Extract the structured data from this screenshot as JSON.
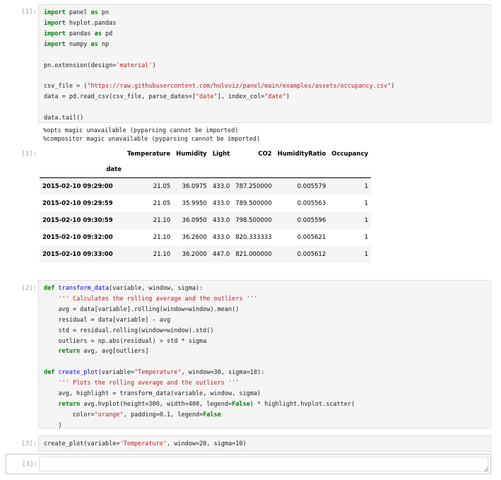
{
  "cells": {
    "c1": {
      "prompt": "[1]:",
      "lines": [
        [
          [
            "kw",
            "import"
          ],
          [
            "t",
            " panel "
          ],
          [
            "kw",
            "as"
          ],
          [
            "t",
            " pn"
          ]
        ],
        [
          [
            "kw",
            "import"
          ],
          [
            "t",
            " hvplot.pandas"
          ]
        ],
        [
          [
            "kw",
            "import"
          ],
          [
            "t",
            " pandas "
          ],
          [
            "kw",
            "as"
          ],
          [
            "t",
            " pd"
          ]
        ],
        [
          [
            "kw",
            "import"
          ],
          [
            "t",
            " numpy "
          ],
          [
            "kw",
            "as"
          ],
          [
            "t",
            " np"
          ]
        ],
        [],
        [
          [
            "t",
            "pn.extension(design="
          ],
          [
            "str",
            "'material'"
          ],
          [
            "t",
            ")"
          ]
        ],
        [],
        [
          [
            "t",
            "csv_file = ("
          ],
          [
            "str",
            "\"https://raw.githubusercontent.com/holoviz/panel/main/examples/assets/occupancy.csv\""
          ],
          [
            "t",
            ")"
          ]
        ],
        [
          [
            "t",
            "data = pd.read_csv(csv_file, parse_dates=["
          ],
          [
            "str",
            "\"date\""
          ],
          [
            "t",
            "], index_col="
          ],
          [
            "str",
            "\"date\""
          ],
          [
            "t",
            ")"
          ]
        ],
        [],
        [
          [
            "t",
            "data.tail()"
          ]
        ]
      ]
    },
    "stdout": "%opts magic unavailable (pyparsing cannot be imported)\n%compositor magic unavailable (pyparsing cannot be imported)",
    "out1": {
      "prompt": "[1]:",
      "columns": [
        "Temperature",
        "Humidity",
        "Light",
        "CO2",
        "HumidityRatio",
        "Occupancy"
      ],
      "index_name": "date",
      "rows": [
        {
          "index": "2015-02-10 09:29:00",
          "values": [
            "21.05",
            "36.0975",
            "433.0",
            "787.250000",
            "0.005579",
            "1"
          ]
        },
        {
          "index": "2015-02-10 09:29:59",
          "values": [
            "21.05",
            "35.9950",
            "433.0",
            "789.500000",
            "0.005563",
            "1"
          ]
        },
        {
          "index": "2015-02-10 09:30:59",
          "values": [
            "21.10",
            "36.0950",
            "433.0",
            "798.500000",
            "0.005596",
            "1"
          ]
        },
        {
          "index": "2015-02-10 09:32:00",
          "values": [
            "21.10",
            "36.2600",
            "433.0",
            "820.333333",
            "0.005621",
            "1"
          ]
        },
        {
          "index": "2015-02-10 09:33:00",
          "values": [
            "21.10",
            "36.2000",
            "447.0",
            "821.000000",
            "0.005612",
            "1"
          ]
        }
      ]
    },
    "c2": {
      "prompt": "[2]:",
      "lines": [
        [
          [
            "kw",
            "def"
          ],
          [
            "t",
            " "
          ],
          [
            "fn",
            "transform_data"
          ],
          [
            "t",
            "(variable, window, sigma):"
          ]
        ],
        [
          [
            "t",
            "    "
          ],
          [
            "str",
            "''' Calculates the rolling average and the outliers '''"
          ]
        ],
        [
          [
            "t",
            "    avg = data[variable].rolling(window=window).mean()"
          ]
        ],
        [
          [
            "t",
            "    residual = data[variable] - avg"
          ]
        ],
        [
          [
            "t",
            "    std = residual.rolling(window=window).std()"
          ]
        ],
        [
          [
            "t",
            "    outliers = np.abs(residual) > std * sigma"
          ]
        ],
        [
          [
            "t",
            "    "
          ],
          [
            "kw",
            "return"
          ],
          [
            "t",
            " avg, avg[outliers]"
          ]
        ],
        [],
        [
          [
            "kw",
            "def"
          ],
          [
            "t",
            " "
          ],
          [
            "fn",
            "create_plot"
          ],
          [
            "t",
            "(variable="
          ],
          [
            "str",
            "\"Temperature\""
          ],
          [
            "t",
            ", window=30, sigma=10):"
          ]
        ],
        [
          [
            "t",
            "    "
          ],
          [
            "str",
            "''' Plots the rolling average and the outliers '''"
          ]
        ],
        [
          [
            "t",
            "    avg, highlight = transform_data(variable, window, sigma)"
          ]
        ],
        [
          [
            "t",
            "    "
          ],
          [
            "kw",
            "return"
          ],
          [
            "t",
            " avg.hvplot(height=300, width=400, legend="
          ],
          [
            "kw",
            "False"
          ],
          [
            "t",
            ") * highlight.hvplot.scatter("
          ]
        ],
        [
          [
            "t",
            "        color="
          ],
          [
            "str",
            "\"orange\""
          ],
          [
            "t",
            ", padding=0.1, legend="
          ],
          [
            "kw",
            "False"
          ]
        ],
        [
          [
            "t",
            "    )"
          ]
        ]
      ]
    },
    "c3": {
      "prompt": "[3]:",
      "lines": [
        [
          [
            "t",
            "create_plot(variable="
          ],
          [
            "str",
            "'Temperature'"
          ],
          [
            "t",
            ", window=20, sigma=10)"
          ]
        ]
      ]
    },
    "active": {
      "prompt": "[3]:"
    }
  }
}
